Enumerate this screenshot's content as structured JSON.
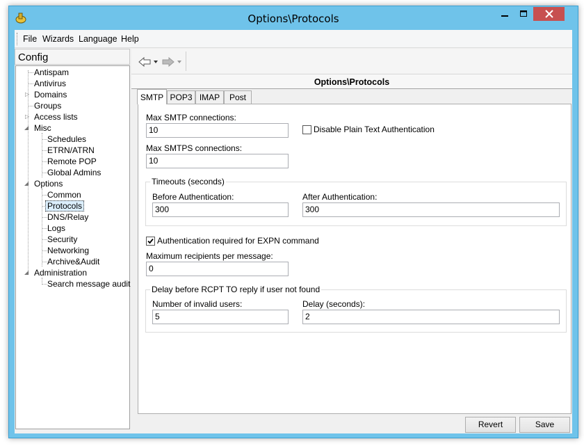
{
  "window": {
    "title": "Options\\Protocols"
  },
  "menu": [
    "File",
    "Wizards",
    "Language",
    "Help"
  ],
  "sidebar": {
    "title": "Config",
    "items": [
      "Antispam",
      "Antivirus",
      "Domains",
      "Groups",
      "Access lists",
      "Misc",
      "Schedules",
      "ETRN/ATRN",
      "Remote POP",
      "Global Admins",
      "Options",
      "Common",
      "Protocols",
      "DNS/Relay",
      "Logs",
      "Security",
      "Networking",
      "Archive&Audit",
      "Administration",
      "Search message audit"
    ]
  },
  "panel": {
    "header": "Options\\Protocols"
  },
  "tabs": [
    "SMTP",
    "POP3",
    "IMAP",
    "Post"
  ],
  "smtp": {
    "max_smtp_label": "Max SMTP connections:",
    "max_smtp_value": "10",
    "max_smtps_label": "Max SMTPS connections:",
    "max_smtps_value": "10",
    "disable_plain_label": "Disable Plain Text Authentication",
    "disable_plain_checked": false,
    "timeouts_title": "Timeouts (seconds)",
    "before_auth_label": "Before Authentication:",
    "before_auth_value": "300",
    "after_auth_label": "After Authentication:",
    "after_auth_value": "300",
    "expn_label": "Authentication required for EXPN command",
    "expn_checked": true,
    "max_recipients_label": "Maximum recipients per message:",
    "max_recipients_value": "0",
    "delay_title": "Delay before RCPT TO reply if user not found",
    "invalid_users_label": "Number of invalid users:",
    "invalid_users_value": "5",
    "delay_seconds_label": "Delay (seconds):",
    "delay_seconds_value": "2"
  },
  "buttons": {
    "revert": "Revert",
    "save": "Save"
  },
  "colors": {
    "frame": "#6fc3ea",
    "close": "#c75050",
    "selection": "#dbeefc"
  }
}
